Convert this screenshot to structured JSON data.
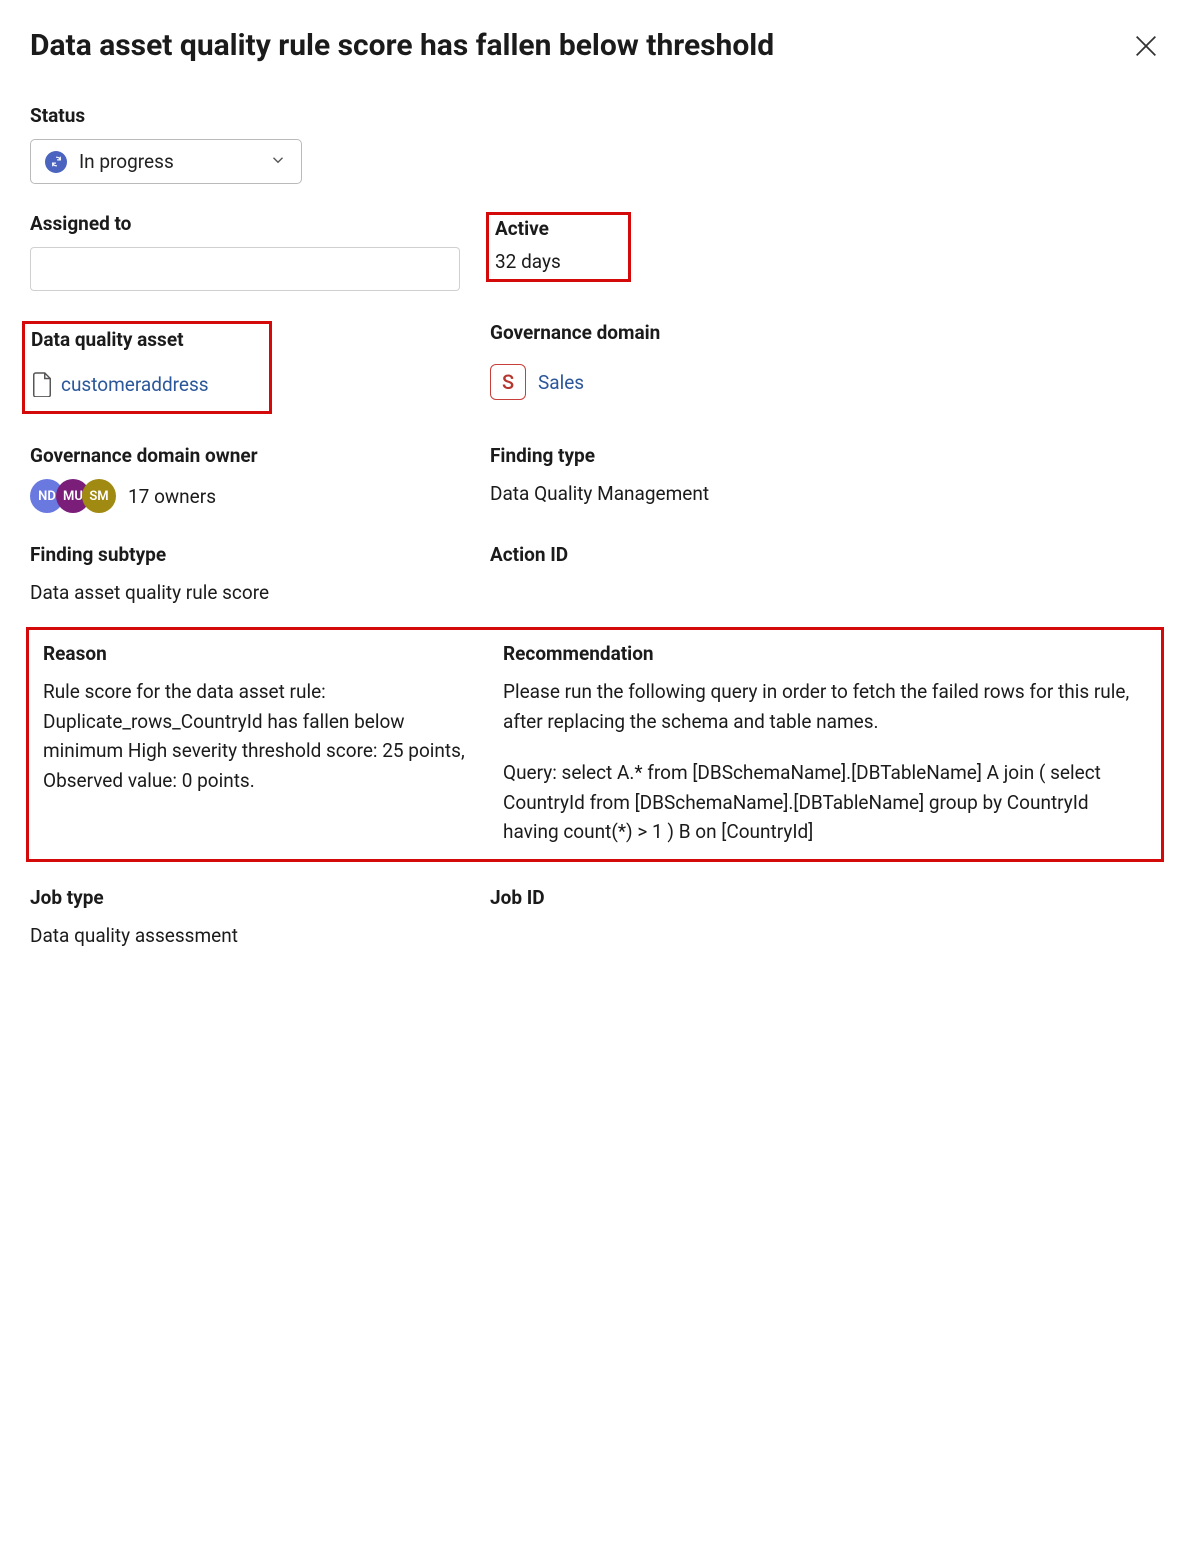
{
  "title": "Data asset quality rule score has fallen below threshold",
  "status": {
    "label": "Status",
    "value": "In progress"
  },
  "assigned_to": {
    "label": "Assigned to",
    "value": ""
  },
  "active": {
    "label": "Active",
    "value": "32 days"
  },
  "data_quality_asset": {
    "label": "Data quality asset",
    "value": "customeraddress"
  },
  "governance_domain": {
    "label": "Governance domain",
    "badge_letter": "S",
    "value": "Sales"
  },
  "governance_domain_owner": {
    "label": "Governance domain owner",
    "avatars": [
      {
        "initials": "ND",
        "bg": "#6a79e0"
      },
      {
        "initials": "MU",
        "bg": "#7a1e7a"
      },
      {
        "initials": "SM",
        "bg": "#a08a12"
      }
    ],
    "count_text": "17 owners"
  },
  "finding_type": {
    "label": "Finding type",
    "value": "Data Quality Management"
  },
  "finding_subtype": {
    "label": "Finding subtype",
    "value": "Data asset quality rule score"
  },
  "action_id": {
    "label": "Action ID",
    "value": ""
  },
  "reason": {
    "label": "Reason",
    "value": "Rule score for the data asset rule: Duplicate_rows_CountryId has fallen below minimum High severity threshold score: 25 points, Observed value: 0 points."
  },
  "recommendation": {
    "label": "Recommendation",
    "para1": "Please run the following query in order to fetch the failed rows for this rule, after replacing the schema and table names.",
    "para2": "Query: select A.* from [DBSchemaName].[DBTableName] A join ( select CountryId from [DBSchemaName].[DBTableName] group by CountryId having count(*) > 1 ) B on [CountryId]"
  },
  "job_type": {
    "label": "Job type",
    "value": "Data quality assessment"
  },
  "job_id": {
    "label": "Job ID",
    "value": ""
  }
}
